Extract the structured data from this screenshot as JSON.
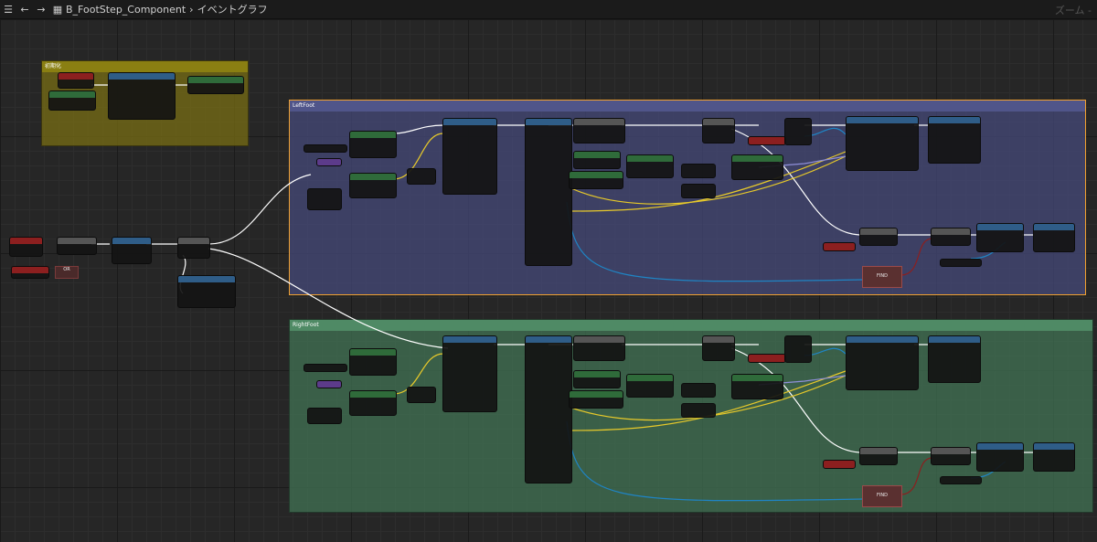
{
  "topbar": {
    "blueprint_name": "B_FootStep_Component",
    "separator": "›",
    "graph_name": "イベントグラフ",
    "zoom_label": "ズーム -",
    "icons": {
      "menu": "menu-icon",
      "back": "back-arrow-icon",
      "forward": "forward-arrow-icon",
      "graph": "graph-icon"
    }
  },
  "comments": {
    "init": {
      "title": "初期化",
      "color": "#6b6417"
    },
    "left": {
      "title": "LeftFoot",
      "color": "#3c3f6a"
    },
    "right": {
      "title": "RightFoot",
      "color": "#3d6a4f"
    }
  },
  "find_label": "FIND",
  "branch_or": "OR",
  "colors": {
    "exec": "#ffffff",
    "bool": "#8c1f1f",
    "object": "#3a7bd5",
    "vector": "#e7c92a",
    "struct": "#1f84c4",
    "selected": "#f0a030"
  }
}
